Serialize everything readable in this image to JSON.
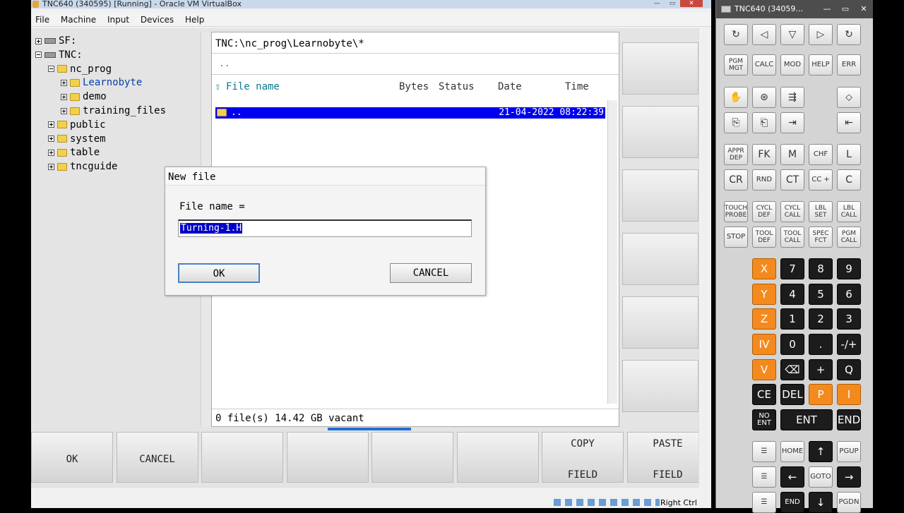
{
  "vbox": {
    "title": "TNC640 (340595) [Running] - Oracle VM VirtualBox",
    "menu": [
      "File",
      "Machine",
      "Input",
      "Devices",
      "Help"
    ],
    "status_text": "Right Ctrl"
  },
  "tree": {
    "items": [
      {
        "label": "SF:",
        "type": "drive",
        "depth": 0,
        "expander": "plus"
      },
      {
        "label": "TNC:",
        "type": "drive",
        "depth": 0,
        "expander": "minus"
      },
      {
        "label": "nc_prog",
        "type": "folder",
        "depth": 1,
        "expander": "minus"
      },
      {
        "label": "Learnobyte",
        "type": "folder",
        "depth": 2,
        "expander": "plus",
        "selected": true
      },
      {
        "label": "demo",
        "type": "folder",
        "depth": 2,
        "expander": "plus"
      },
      {
        "label": "training_files",
        "type": "folder",
        "depth": 2,
        "expander": "plus"
      },
      {
        "label": "public",
        "type": "folder",
        "depth": 1,
        "expander": "plus"
      },
      {
        "label": "system",
        "type": "folder",
        "depth": 1,
        "expander": "plus"
      },
      {
        "label": "table",
        "type": "folder",
        "depth": 1,
        "expander": "plus"
      },
      {
        "label": "tncguide",
        "type": "folder",
        "depth": 1,
        "expander": "plus"
      }
    ]
  },
  "filelist": {
    "path": "TNC:\\nc_prog\\Learnobyte\\*",
    "parent": "..",
    "headers": {
      "name": "File name",
      "bytes": "Bytes",
      "status": "Status",
      "date": "Date",
      "time": "Time"
    },
    "rows": [
      {
        "name": "..",
        "date_time": "21-04-2022 08:22:39"
      }
    ],
    "status": "0    file(s)  14.42 GB vacant"
  },
  "dialog": {
    "title": "New file",
    "label": "File name =",
    "value": "Turning-1.H",
    "ok": "OK",
    "cancel": "CANCEL"
  },
  "softkeys_bottom": [
    {
      "line1": "OK",
      "line2": ""
    },
    {
      "line1": "CANCEL",
      "line2": ""
    },
    {
      "line1": "",
      "line2": ""
    },
    {
      "line1": "",
      "line2": ""
    },
    {
      "line1": "",
      "line2": ""
    },
    {
      "line1": "",
      "line2": ""
    },
    {
      "line1": "COPY",
      "line2": "FIELD"
    },
    {
      "line1": "PASTE",
      "line2": "FIELD"
    }
  ],
  "keyboard": {
    "title": "TNC640 (34059...",
    "rows": [
      [
        "↻",
        "◁",
        "▽",
        "▷",
        "↻"
      ],
      [
        "PGM MGT",
        "CALC",
        "MOD",
        "HELP",
        "ERR"
      ],
      [
        "✋",
        "⊛",
        "⇶",
        "",
        "⬦"
      ],
      [
        "⎘",
        "⎗",
        "⇥",
        "",
        "⇤"
      ],
      [
        "APPR DEP",
        "FK",
        "M",
        "CHF",
        "L"
      ],
      [
        "CR",
        "RND",
        "CT",
        "CC +",
        "C"
      ],
      [
        "TOUCH PROBE",
        "CYCL DEF",
        "CYCL CALL",
        "LBL SET",
        "LBL CALL"
      ],
      [
        "STOP",
        "TOOL DEF",
        "TOOL CALL",
        "SPEC FCT",
        "PGM CALL"
      ]
    ],
    "numpad": [
      [
        "X",
        "7",
        "8",
        "9"
      ],
      [
        "Y",
        "4",
        "5",
        "6"
      ],
      [
        "Z",
        "1",
        "2",
        "3"
      ],
      [
        "IV",
        "0",
        ".",
        "-/+"
      ],
      [
        "V",
        "⌫",
        "+",
        "Q"
      ],
      [
        "CE",
        "DEL",
        "P",
        "I"
      ],
      [
        "NO ENT",
        "ENT",
        "END"
      ],
      [
        "☰",
        "HOME",
        "↑",
        "PGUP"
      ],
      [
        "☰",
        "←",
        "GOTO",
        "→"
      ],
      [
        "☰",
        "END",
        "↓",
        "PGDN"
      ]
    ]
  }
}
